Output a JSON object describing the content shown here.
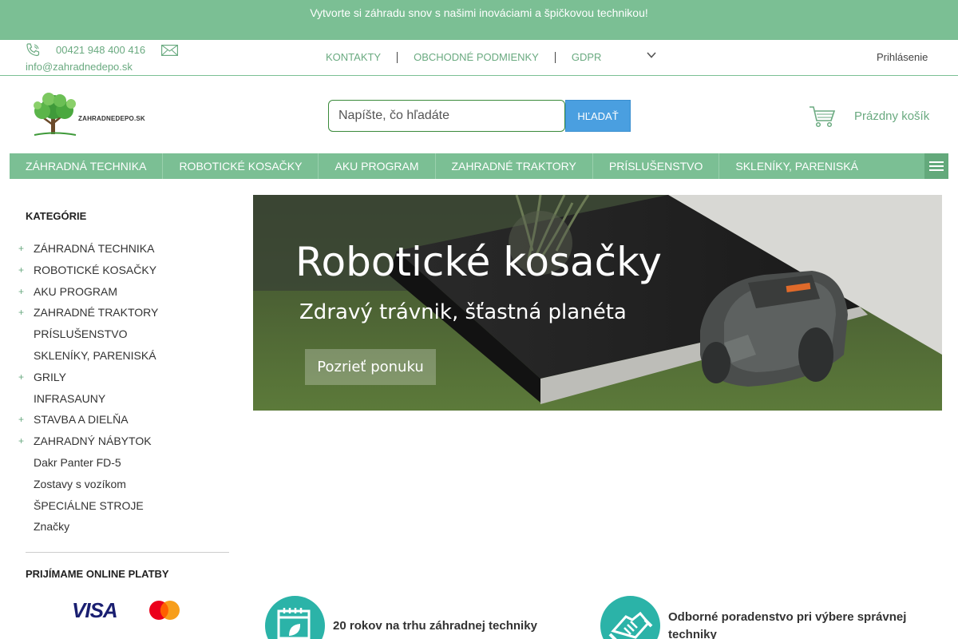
{
  "promo": {
    "text": "Vytvorte si záhradu snov s našimi inováciami a špičkovou technikou!"
  },
  "contact": {
    "phone": "00421 948 400 416",
    "email": "info@zahradnedepo.sk",
    "phone_icon": "phone-icon",
    "mail_icon": "envelope-icon"
  },
  "toplinks": {
    "contacts": "KONTAKTY",
    "terms": "OBCHODNÉ PODMIENKY",
    "gdpr": "GDPR"
  },
  "login": "Prihlásenie",
  "logo": {
    "text": "ZAHRADNEDEPO.SK"
  },
  "search": {
    "placeholder": "Napíšte, čo hľadáte",
    "button": "HĽADAŤ"
  },
  "cart": {
    "label": "Prázdny košík",
    "icon": "cart-icon"
  },
  "nav": {
    "items": [
      "ZÁHRADNÁ TECHNIKA",
      "ROBOTICKÉ KOSAČKY",
      "AKU PROGRAM",
      "ZAHRADNÉ TRAKTORY",
      "PRÍSLUŠENSTVO",
      "SKLENÍKY, PARENISKÁ"
    ],
    "menu_icon": "hamburger-icon"
  },
  "sidebar": {
    "title": "KATEGÓRIE",
    "categories": [
      {
        "label": "ZÁHRADNÁ TECHNIKA",
        "expandable": "+"
      },
      {
        "label": "ROBOTICKÉ KOSAČKY",
        "expandable": "+"
      },
      {
        "label": "AKU PROGRAM",
        "expandable": "+"
      },
      {
        "label": "ZAHRADNÉ TRAKTORY",
        "expandable": "+"
      },
      {
        "label": "PRÍSLUŠENSTVO",
        "expandable": ""
      },
      {
        "label": "SKLENÍKY, PARENISKÁ",
        "expandable": ""
      },
      {
        "label": "GRILY",
        "expandable": "+"
      },
      {
        "label": "INFRASAUNY",
        "expandable": ""
      },
      {
        "label": "STAVBA A DIELŇA",
        "expandable": "+"
      },
      {
        "label": "ZAHRADNÝ NÁBYTOK",
        "expandable": "+"
      },
      {
        "label": "Dakr Panter FD-5",
        "expandable": ""
      },
      {
        "label": "Zostavy s vozíkom",
        "expandable": ""
      },
      {
        "label": "ŠPECIÁLNE STROJE",
        "expandable": ""
      },
      {
        "label": "Značky",
        "expandable": ""
      }
    ],
    "payments_title": "PRIJÍMAME ONLINE PLATBY",
    "visa": "VISA"
  },
  "banner": {
    "title": "Robotické kosačky",
    "subtitle": "Zdravý trávnik, šťastná planéta",
    "button": "Pozrieť ponuku"
  },
  "features": [
    {
      "text": "20 rokov na trhu záhradnej techniky",
      "icon": "calendar-leaf-icon"
    },
    {
      "text": "Odborné poradenstvo pri výbere správnej techniky",
      "icon": "handshake-icon"
    }
  ],
  "colors": {
    "brand_green": "#7bbf94",
    "link_green": "#6aaa80",
    "search_blue": "#4a9fe0",
    "feature_teal": "#2bb3a8"
  }
}
